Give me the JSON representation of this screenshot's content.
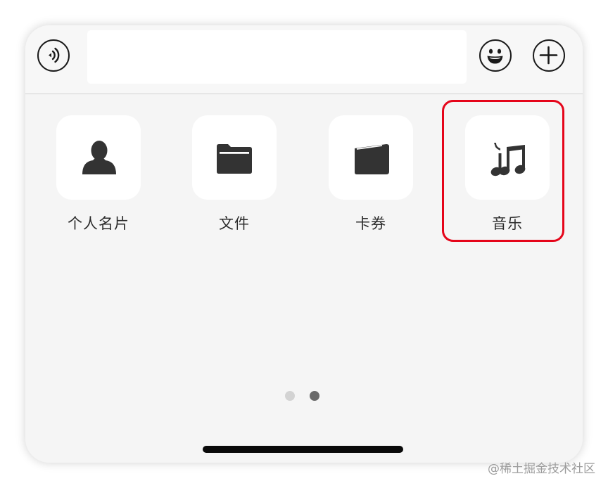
{
  "chat_toolbar": {
    "voice_icon": "voice-icon",
    "emoji_icon": "emoji-icon",
    "more_icon": "plus-icon",
    "input_value": ""
  },
  "panel": {
    "items": [
      {
        "label": "个人名片",
        "icon": "contact-card-icon"
      },
      {
        "label": "文件",
        "icon": "folder-icon"
      },
      {
        "label": "卡券",
        "icon": "wallet-icon"
      },
      {
        "label": "音乐",
        "icon": "music-icon"
      }
    ],
    "highlighted_item": "音乐",
    "highlight_color": "#e5051a",
    "page_indicator": {
      "total_pages": 2,
      "current_page": 2
    }
  },
  "watermark": "@稀土掘金技术社区"
}
